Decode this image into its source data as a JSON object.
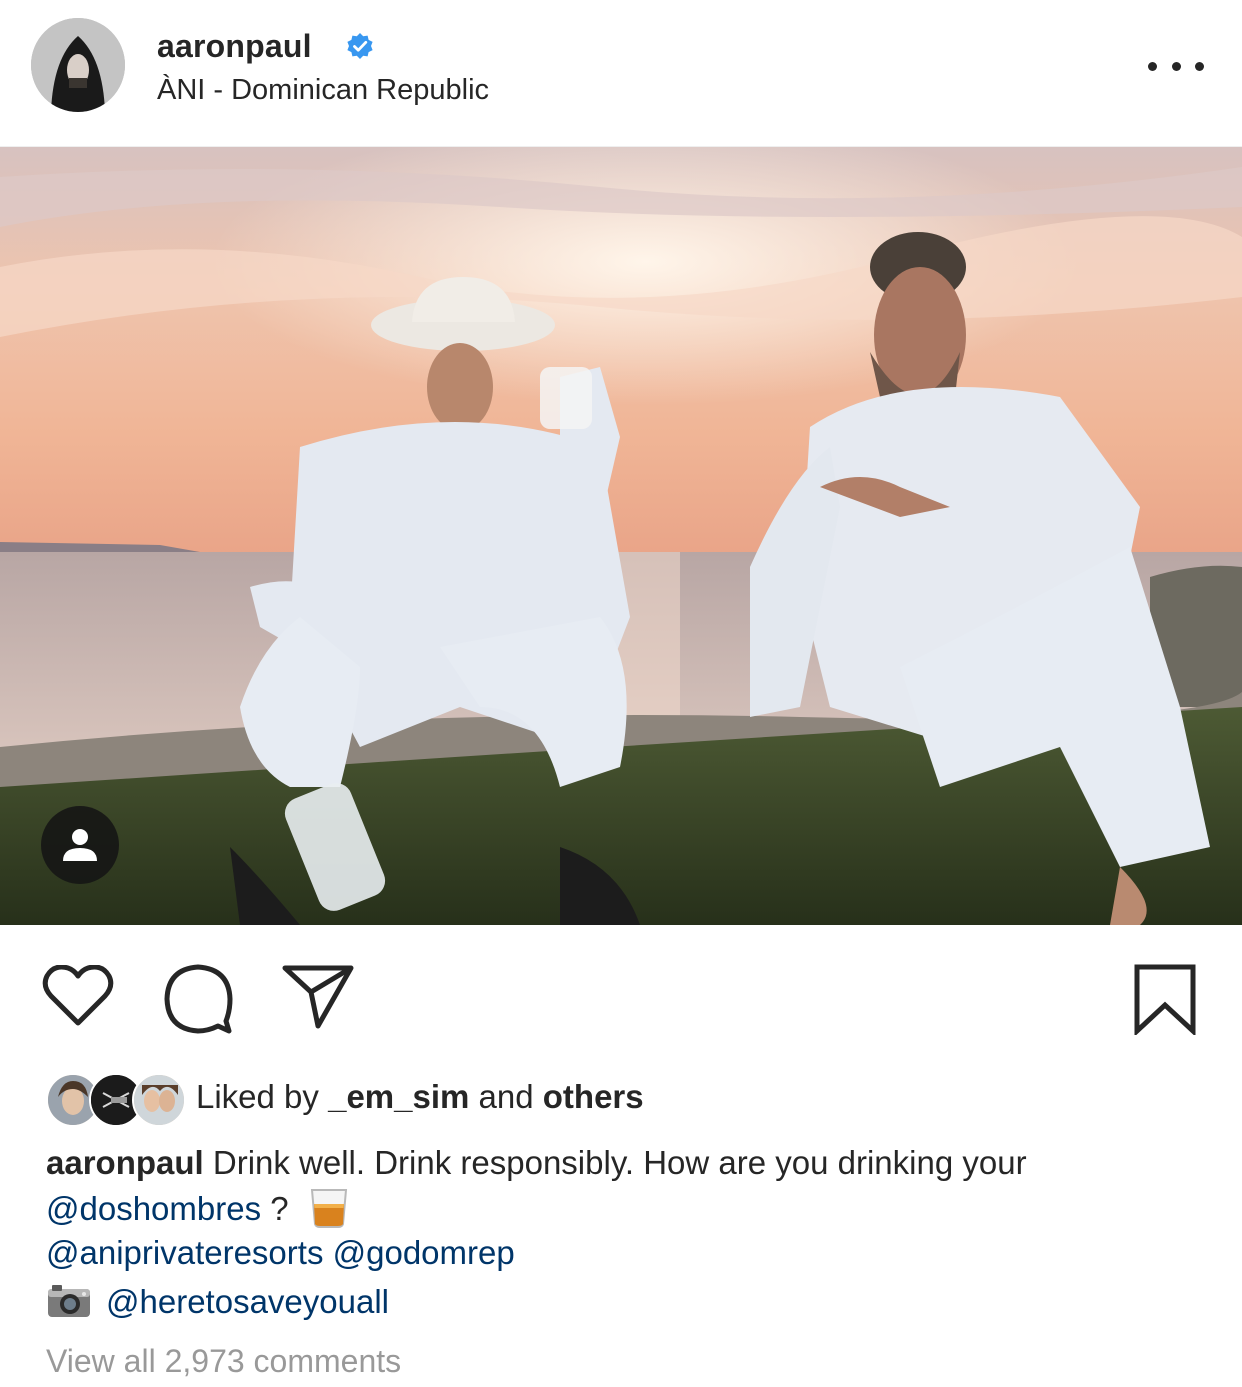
{
  "post": {
    "username": "aaronpaul",
    "location": "ÀNI - Dominican Republic",
    "verified": true
  },
  "likes": {
    "prefix": "Liked by ",
    "user": "_em_sim",
    "middle": " and ",
    "others": "others"
  },
  "caption": {
    "author": "aaronpaul",
    "line1_text": " Drink well. Drink responsibly. How are you drinking your",
    "mention1": "@doshombres",
    "line2_suffix": " ?",
    "mention2": "@aniprivateresorts",
    "mention3": "@godomrep",
    "mention4": "@heretosaveyouall"
  },
  "comments": {
    "view_all": "View all 2,973 comments"
  },
  "icons": {
    "more": "more-options-icon",
    "like": "heart-icon",
    "comment": "comment-icon",
    "share": "send-icon",
    "save": "bookmark-icon",
    "tag": "user-tag-icon",
    "glass": "tumbler-glass-emoji",
    "camera": "camera-emoji"
  },
  "colors": {
    "text": "#262626",
    "mention": "#003569",
    "muted": "#999999",
    "verified": "#3897f0"
  }
}
